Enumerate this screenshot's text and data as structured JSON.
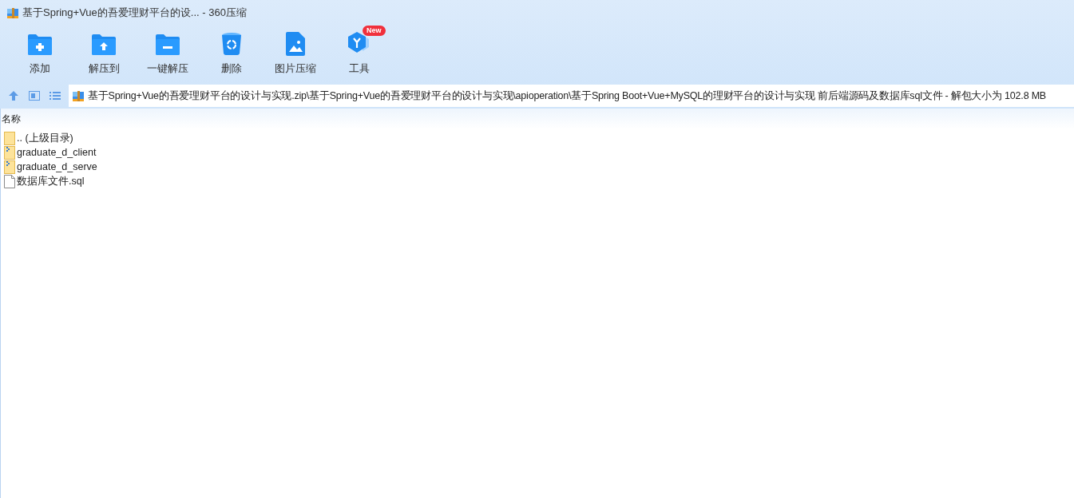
{
  "window": {
    "title": "基于Spring+Vue的吾爱理财平台的设... - 360压缩"
  },
  "toolbar": [
    {
      "kind": "add",
      "label": "添加"
    },
    {
      "kind": "extract-to",
      "label": "解压到"
    },
    {
      "kind": "one-click",
      "label": "一键解压"
    },
    {
      "kind": "delete",
      "label": "删除"
    },
    {
      "kind": "image",
      "label": "图片压缩"
    },
    {
      "kind": "tools",
      "label": "工具",
      "badge": "New"
    }
  ],
  "address": {
    "path": "基于Spring+Vue的吾爱理财平台的设计与实现.zip\\基于Spring+Vue的吾爱理财平台的设计与实现\\apioperation\\基于Spring Boot+Vue+MySQL的理财平台的设计与实现 前后端源码及数据库sql文件 - 解包大小为 102.8 MB"
  },
  "table": {
    "columns": [
      "名称"
    ],
    "rows": [
      {
        "kind": "folder",
        "name": ".. (上级目录)"
      },
      {
        "kind": "zip-folder",
        "name": "graduate_d_client"
      },
      {
        "kind": "zip-folder",
        "name": "graduate_d_serve"
      },
      {
        "kind": "file",
        "name": "数据库文件.sql"
      }
    ]
  }
}
